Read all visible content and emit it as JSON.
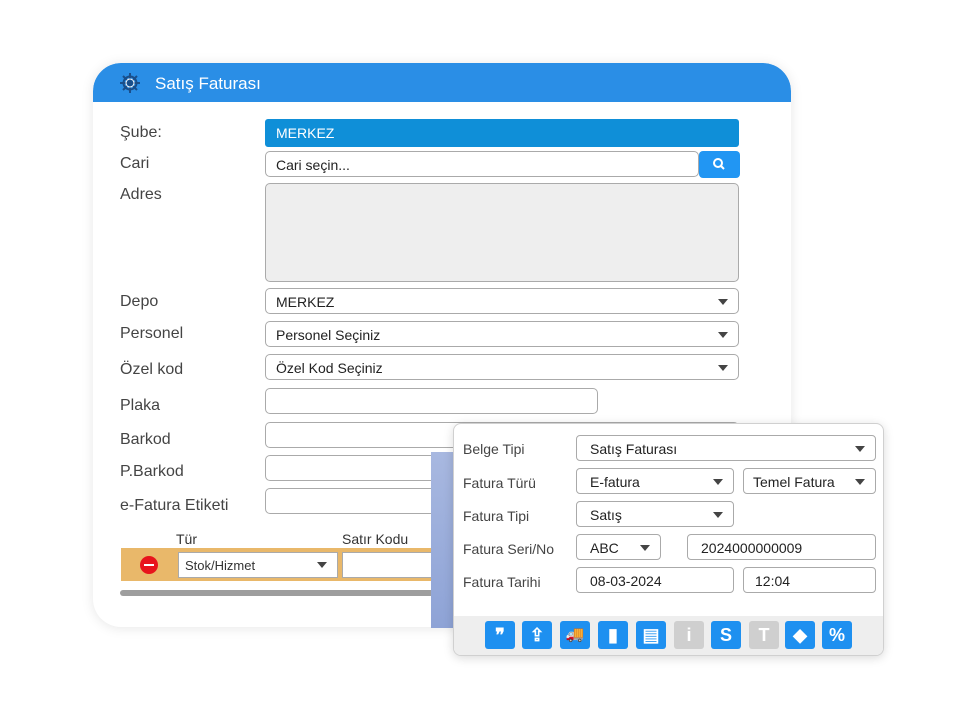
{
  "window": {
    "title": "Satış Faturası"
  },
  "form": {
    "sube": {
      "label": "Şube:",
      "value": "MERKEZ"
    },
    "cari": {
      "label": "Cari",
      "placeholder": "Cari seçin..."
    },
    "adres": {
      "label": "Adres",
      "value": ""
    },
    "depo": {
      "label": "Depo",
      "value": "MERKEZ"
    },
    "personel": {
      "label": "Personel",
      "value": "Personel Seçiniz"
    },
    "ozel_kod": {
      "label": "Özel kod",
      "value": "Özel Kod Seçiniz"
    },
    "plaka": {
      "label": "Plaka",
      "value": ""
    },
    "barkod": {
      "label": "Barkod",
      "value": ""
    },
    "p_barkod": {
      "label": "P.Barkod",
      "value": ""
    },
    "efatura_etiketi": {
      "label": "e-Fatura Etiketi",
      "value": ""
    }
  },
  "grid": {
    "columns": [
      "Tür",
      "Satır Kodu"
    ],
    "rows": [
      {
        "tur": "Stok/Hizmet",
        "satir_kodu": ""
      }
    ]
  },
  "popup": {
    "belge_tipi": {
      "label": "Belge Tipi",
      "value": "Satış Faturası"
    },
    "fatura_turu": {
      "label": "Fatura Türü",
      "value": "E-fatura",
      "value2": "Temel Fatura"
    },
    "fatura_tipi": {
      "label": "Fatura Tipi",
      "value": "Satış"
    },
    "fatura_seri_no": {
      "label": "Fatura Seri/No",
      "seri": "ABC",
      "no": "2024000000009"
    },
    "fatura_tarihi": {
      "label": "Fatura Tarihi",
      "date": "08-03-2024",
      "time": "12:04"
    },
    "toolbar": [
      {
        "icon": "quote-icon",
        "glyph": "❞",
        "enabled": true
      },
      {
        "icon": "upload-icon",
        "glyph": "⇪",
        "enabled": true
      },
      {
        "icon": "truck-icon",
        "glyph": "🚚",
        "enabled": true
      },
      {
        "icon": "bar-chart-icon",
        "glyph": "▮",
        "enabled": true
      },
      {
        "icon": "book-icon",
        "glyph": "▤",
        "enabled": true
      },
      {
        "icon": "info-icon",
        "glyph": "i",
        "enabled": false
      },
      {
        "icon": "s-icon",
        "glyph": "S",
        "enabled": true
      },
      {
        "icon": "t-icon",
        "glyph": "T",
        "enabled": false
      },
      {
        "icon": "tag-icon",
        "glyph": "◆",
        "enabled": true
      },
      {
        "icon": "percent-icon",
        "glyph": "%",
        "enabled": true
      }
    ]
  },
  "colors": {
    "accent": "#2a8ee6",
    "sube_bg": "#0f8fd8",
    "row_bg": "#e9b86a",
    "remove": "#e8141c"
  }
}
